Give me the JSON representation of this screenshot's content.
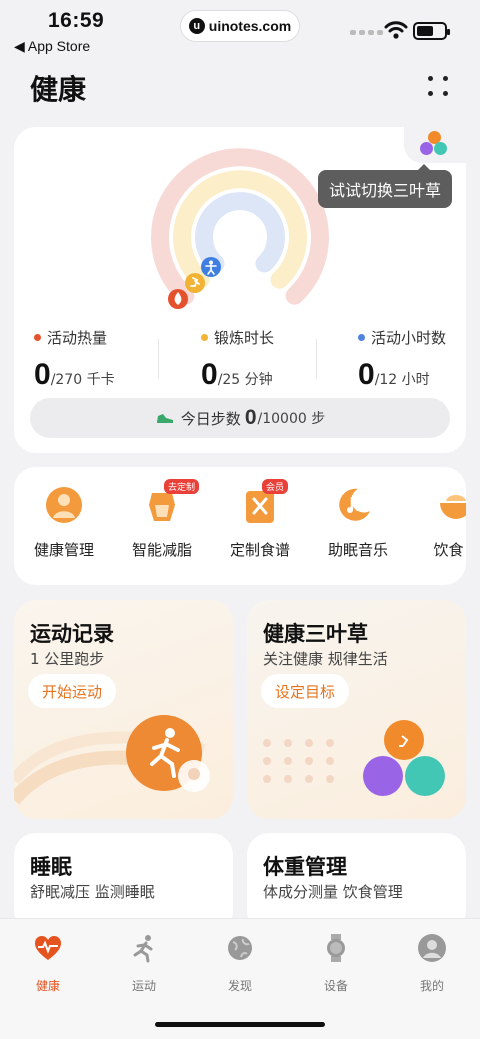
{
  "status": {
    "time": "16:59",
    "back_label": "◀ App Store",
    "url": "uinotes.com",
    "url_logo": "u"
  },
  "header": {
    "title": "健康"
  },
  "rings_card": {
    "tooltip": "试试切换三叶草",
    "stats": [
      {
        "label": "活动热量",
        "value": "0",
        "target": "/270 千卡",
        "color": "#e5502d"
      },
      {
        "label": "锻炼时长",
        "value": "0",
        "target": "/25 分钟",
        "color": "#f2b233"
      },
      {
        "label": "活动小时数",
        "value": "0",
        "target": "/12 小时",
        "color": "#4f83e0"
      }
    ],
    "steps": {
      "label": "今日步数",
      "value": "0",
      "target": "/10000 步"
    }
  },
  "shortcuts": [
    {
      "label": "健康管理",
      "icon": "health-manage-icon",
      "badge": ""
    },
    {
      "label": "智能减脂",
      "icon": "fat-loss-icon",
      "badge": "去定制"
    },
    {
      "label": "定制食谱",
      "icon": "recipe-book-icon",
      "badge": "会员"
    },
    {
      "label": "助眠音乐",
      "icon": "sleep-music-icon",
      "badge": ""
    },
    {
      "label": "饮食日",
      "icon": "diet-bowl-icon",
      "badge": ""
    }
  ],
  "cards": {
    "run": {
      "title": "运动记录",
      "subtitle": "1 公里跑步",
      "button": "开始运动"
    },
    "clover": {
      "title": "健康三叶草",
      "subtitle": "关注健康 规律生活",
      "button": "设定目标"
    },
    "sleep": {
      "title": "睡眠",
      "subtitle": "舒眠减压 监测睡眠"
    },
    "weight": {
      "title": "体重管理",
      "subtitle": "体成分测量 饮食管理"
    }
  },
  "tabs": [
    {
      "label": "健康",
      "icon": "heart-pulse-icon",
      "active": true
    },
    {
      "label": "运动",
      "icon": "runner-icon",
      "active": false
    },
    {
      "label": "发现",
      "icon": "globe-icon",
      "active": false
    },
    {
      "label": "设备",
      "icon": "watch-icon",
      "active": false
    },
    {
      "label": "我的",
      "icon": "profile-icon",
      "active": false
    }
  ],
  "colors": {
    "accent": "#e5541f",
    "move": "#e5502d",
    "exercise": "#f2b233",
    "stand": "#4f83e0"
  }
}
